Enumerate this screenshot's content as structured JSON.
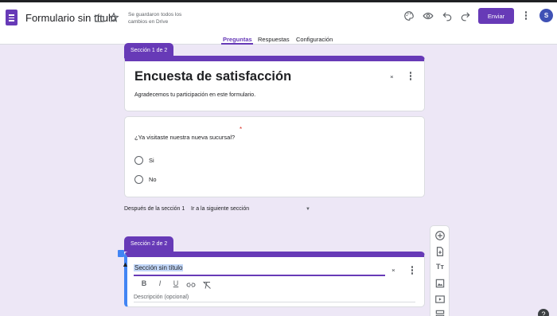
{
  "header": {
    "title": "Formulario sin título",
    "save_status": "Se guardaron todos los cambios en Drive",
    "send_label": "Enviar",
    "avatar_letter": "S"
  },
  "tabs": [
    {
      "label": "Preguntas",
      "active": true
    },
    {
      "label": "Respuestas",
      "active": false
    },
    {
      "label": "Configuración",
      "active": false
    }
  ],
  "section1": {
    "tab": "Sección 1 de 2",
    "title": "Encuesta de satisfacción",
    "description": "Agradecemos tu participación en este formulario."
  },
  "question": {
    "text": "¿Ya visitaste nuestra nueva sucursal?",
    "required_mark": "*",
    "options": [
      "Si",
      "No"
    ]
  },
  "after_section": {
    "label": "Después de la sección 1",
    "value": "Ir a la siguiente sección"
  },
  "section2": {
    "tab": "Sección 2 de 2",
    "title": "Sección sin título",
    "description_placeholder": "Descripción (opcional)"
  },
  "icons": {
    "bold": "B",
    "italic": "I",
    "underline": "U",
    "text_item": "Tт",
    "help": "?"
  },
  "colors": {
    "accent": "#673ab7",
    "background": "#ede7f6",
    "focus": "#4285f4",
    "required": "#d93025"
  }
}
